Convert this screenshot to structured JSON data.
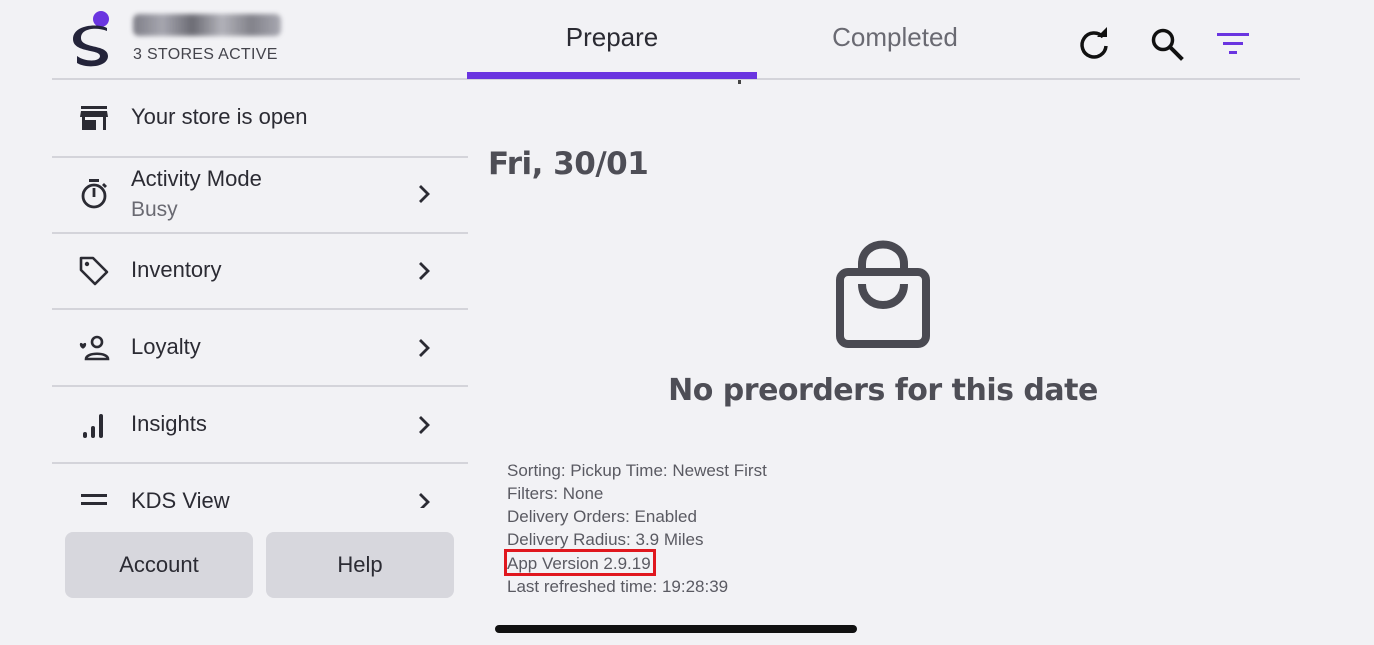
{
  "header": {
    "stores_active": "3 STORES ACTIVE",
    "tabs": [
      {
        "label": "Prepare",
        "active": true
      },
      {
        "label": "Completed",
        "active": false
      }
    ],
    "icons": [
      "refresh-icon",
      "search-icon",
      "filter-icon"
    ],
    "accent_color": "#6a35e0"
  },
  "sidebar": {
    "items": [
      {
        "label": "Your store is open",
        "icon": "storefront-icon"
      },
      {
        "label": "Activity Mode",
        "sublabel": "Busy",
        "icon": "timer-icon"
      },
      {
        "label": "Inventory",
        "icon": "tag-icon"
      },
      {
        "label": "Loyalty",
        "icon": "loyalty-person-icon"
      },
      {
        "label": "Insights",
        "icon": "signal-bars-icon"
      },
      {
        "label": "KDS View",
        "icon": "menu-lines-icon"
      }
    ],
    "buttons": {
      "account": "Account",
      "help": "Help"
    }
  },
  "main": {
    "date": "Fri, 30/01",
    "empty_message": "No preorders for this date",
    "info_lines": [
      "Sorting: Pickup Time: Newest First",
      "Filters: None",
      "Delivery Orders: Enabled",
      "Delivery Radius: 3.9 Miles",
      "App Version 2.9.19",
      "Last refreshed time: 19:28:39"
    ],
    "highlight_color": "#e0171e"
  }
}
